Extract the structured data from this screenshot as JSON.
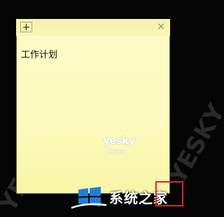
{
  "note": {
    "add_symbol": "+",
    "close_symbol": "×",
    "text": "工作计划",
    "watermark": "yesky",
    "watermark_sub": "天极网"
  },
  "brand": {
    "text": "系统之家"
  },
  "icons": {
    "add": "plus-icon",
    "close": "close-icon",
    "brand": "windows-logo-icon"
  },
  "colors": {
    "note_background": "#fdfbc0",
    "highlight_box": "#d62828"
  }
}
